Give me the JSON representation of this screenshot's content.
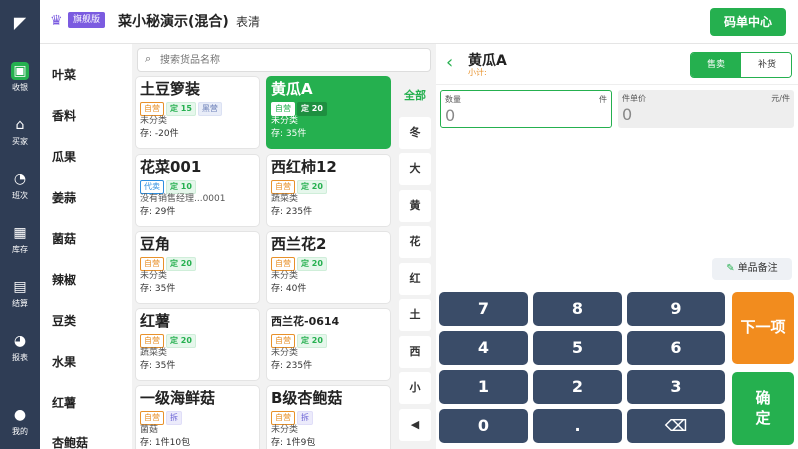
{
  "header": {
    "logo": "◤",
    "crown_icon": "♛",
    "vip_badge": "旗舰版",
    "store_name": "菜小秘演示(混合)",
    "user_name": "表清",
    "order_center": "码单中心"
  },
  "nav": [
    {
      "icon": "cashier-icon",
      "glyph": "▣",
      "label": "收银"
    },
    {
      "icon": "basket-icon",
      "glyph": "⌂",
      "label": "买家"
    },
    {
      "icon": "pie-icon",
      "glyph": "◔",
      "label": "班次"
    },
    {
      "icon": "warehouse-icon",
      "glyph": "▦",
      "label": "库存"
    },
    {
      "icon": "truck-icon",
      "glyph": "▤",
      "label": "结算"
    },
    {
      "icon": "report-icon",
      "glyph": "◕",
      "label": "报表"
    },
    {
      "icon": "user-icon",
      "glyph": "●",
      "label": "我的"
    }
  ],
  "categories": [
    "叶菜",
    "香料",
    "瓜果",
    "姜蒜",
    "菌菇",
    "辣椒",
    "豆类",
    "水果",
    "红薯",
    "杏鲍菇"
  ],
  "search": {
    "placeholder": "搜索货品名称",
    "icon": "⌕"
  },
  "products": [
    {
      "name": "土豆箩装",
      "tags": [
        {
          "t": "自营",
          "k": "ziying"
        },
        {
          "t": "定 15",
          "k": "ding"
        },
        {
          "t": "黑营",
          "k": "heiying"
        }
      ],
      "cls": "未分类",
      "stock": "存: -20件"
    },
    {
      "name": "黄瓜A",
      "tags": [
        {
          "t": "自营",
          "k": "ziying"
        },
        {
          "t": "定 20",
          "k": "ding"
        }
      ],
      "cls": "未分类",
      "stock": "存: 35件",
      "selected": true
    },
    {
      "name": "花菜001",
      "tags": [
        {
          "t": "代卖",
          "k": "daimai"
        },
        {
          "t": "定 10",
          "k": "ding"
        }
      ],
      "cls": "没有销售经理...0001",
      "stock": "存: 29件"
    },
    {
      "name": "西红柿12",
      "tags": [
        {
          "t": "自营",
          "k": "ziying"
        },
        {
          "t": "定 20",
          "k": "ding"
        }
      ],
      "cls": "蔬菜类",
      "stock": "存: 235件"
    },
    {
      "name": "豆角",
      "tags": [
        {
          "t": "自营",
          "k": "ziying"
        },
        {
          "t": "定 20",
          "k": "ding"
        }
      ],
      "cls": "未分类",
      "stock": "存: 35件"
    },
    {
      "name": "西兰花2",
      "tags": [
        {
          "t": "自营",
          "k": "ziying"
        },
        {
          "t": "定 20",
          "k": "ding"
        }
      ],
      "cls": "未分类",
      "stock": "存: 40件"
    },
    {
      "name": "红薯",
      "tags": [
        {
          "t": "自营",
          "k": "ziying"
        },
        {
          "t": "定 20",
          "k": "ding"
        }
      ],
      "cls": "蔬菜类",
      "stock": "存: 35件"
    },
    {
      "name": "西兰花-0614",
      "small": true,
      "tags": [
        {
          "t": "自营",
          "k": "ziying"
        },
        {
          "t": "定 20",
          "k": "ding"
        }
      ],
      "cls": "未分类",
      "stock": "存: 235件"
    },
    {
      "name": "一级海鲜菇",
      "tags": [
        {
          "t": "自营",
          "k": "ziying"
        },
        {
          "t": "拆",
          "k": "chai"
        }
      ],
      "cls": "菌菇",
      "stock": "存: 1件10包"
    },
    {
      "name": "B级杏鲍菇",
      "tags": [
        {
          "t": "自营",
          "k": "ziying"
        },
        {
          "t": "拆",
          "k": "chai"
        }
      ],
      "cls": "未分类",
      "stock": "存: 1件9包"
    }
  ],
  "index_letters": [
    "全部",
    "冬",
    "大",
    "黄",
    "花",
    "红",
    "土",
    "西",
    "小",
    "◀"
  ],
  "detail": {
    "back": "‹",
    "title": "黄瓜A",
    "subtitle": "小计:",
    "toggle_on": "售卖",
    "toggle_off": "补货",
    "qty_label": "数量",
    "qty_unit": "件",
    "qty_value": "0",
    "price_label": "件单价",
    "price_unit": "元/件",
    "price_value": "0",
    "note_icon": "✎",
    "note_label": "单品备注"
  },
  "keypad": {
    "k7": "7",
    "k8": "8",
    "k9": "9",
    "k4": "4",
    "k5": "5",
    "k6": "6",
    "k1": "1",
    "k2": "2",
    "k3": "3",
    "k0": "0",
    "kdot": ".",
    "kdel": "⌫",
    "next": "下一项",
    "confirm": "确\n定"
  }
}
